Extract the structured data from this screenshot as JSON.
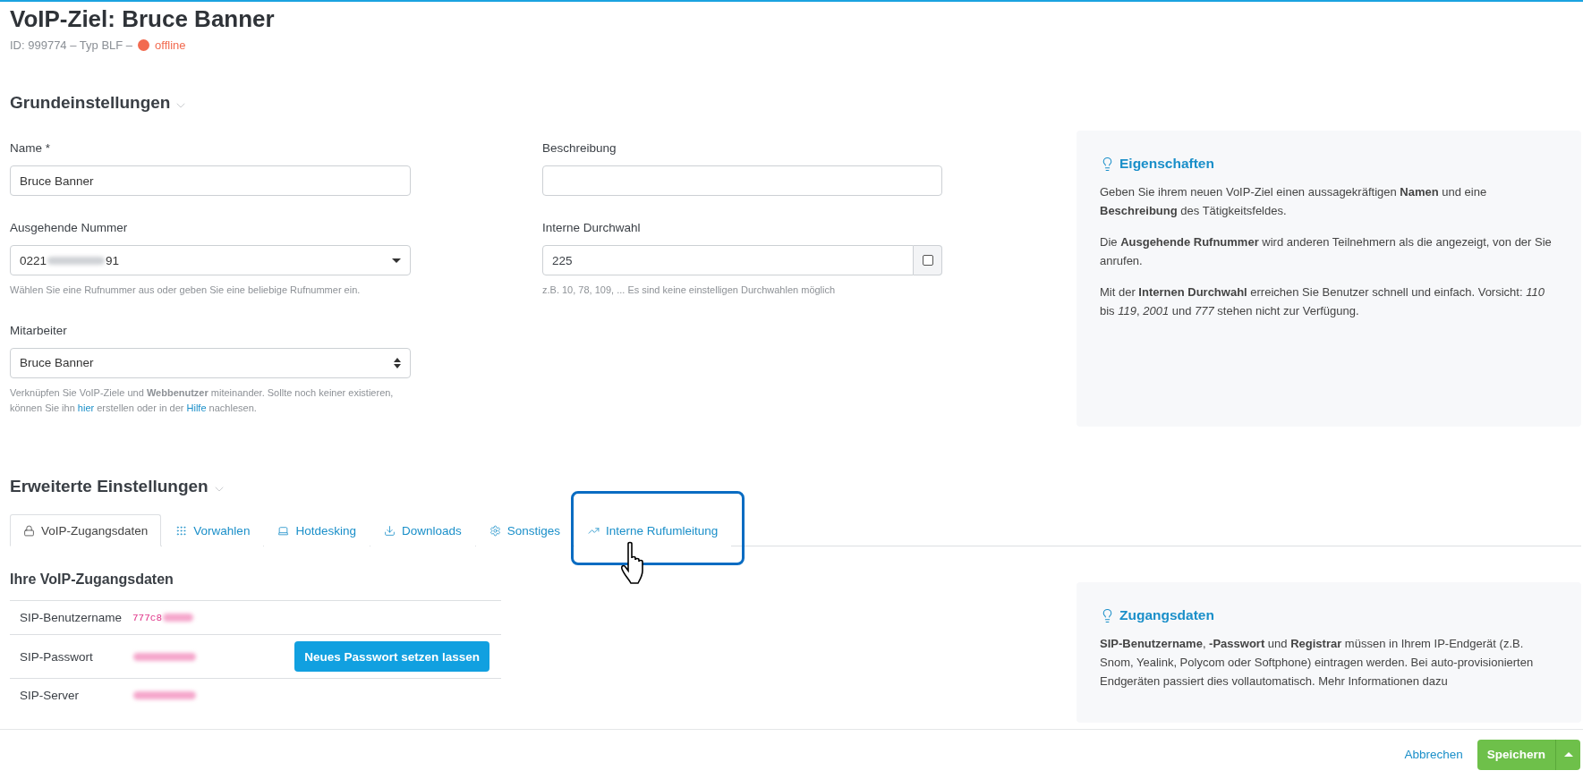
{
  "header": {
    "title": "VoIP-Ziel: Bruce Banner",
    "meta": "ID: 999774 – Typ BLF –",
    "online": false,
    "status": "offline"
  },
  "basic": {
    "title": "Grundeinstellungen",
    "fields": [
      {
        "kind": "text",
        "label": "Name *",
        "value": "Bruce Banner"
      },
      {
        "kind": "text",
        "label": "Beschreibung"
      },
      {
        "kind": "dropdown",
        "label": "Ausgehende Nummer",
        "value": "0221",
        "value_end": "91",
        "blurred": true,
        "hint": [
          {
            "text": "Wählen Sie eine Rufnummer aus oder geben Sie eine beliebige Rufnummer ein."
          }
        ]
      },
      {
        "kind": "checkbox-text",
        "label": "Interne Durchwahl",
        "value": "225",
        "checked": false,
        "hint": [
          {
            "text": "z.B. 10, 78, 109, ... Es sind keine einstelligen Durchwahlen möglich"
          }
        ]
      },
      {
        "kind": "select",
        "label": "Mitarbeiter",
        "value": "Bruce Banner",
        "hint": [
          {
            "text": "Verknüpfen Sie VoIP-Ziele und **Webbenutzer** miteinander. Sollte noch keiner existieren, können Sie ihn "
          },
          {
            "link": "hier"
          },
          {
            "text": " erstellen oder in der "
          },
          {
            "link": "Hilfe"
          },
          {
            "text": " nachlesen."
          }
        ]
      }
    ],
    "info": {
      "title": "Eigenschaften",
      "paragraphs": [
        "Geben Sie ihrem neuen VoIP-Ziel einen aussagekräftigen **Namen** und eine **Beschreibung** des Tätigkeitsfeldes.",
        "Die **Ausgehende Rufnummer** wird anderen Teilnehmern als die angezeigt, von der Sie anrufen.",
        "Mit der **Internen Durchwahl** erreichen Sie Benutzer schnell und einfach. Vorsicht: *110* bis *119*, *2001* und *777* stehen nicht zur Verfügung."
      ]
    }
  },
  "advanced": {
    "title": "Erweiterte Einstellungen",
    "tabs": [
      {
        "label": "VoIP-Zugangsdaten",
        "selected": true
      },
      {
        "label": "Vorwahlen",
        "selected": false
      },
      {
        "label": "Hotdesking",
        "selected": false
      },
      {
        "label": "Downloads",
        "selected": false
      },
      {
        "label": "Sonstiges",
        "selected": false
      },
      {
        "label": "Interne Rufumleitung",
        "selected": false
      }
    ],
    "subtitle": "Ihre VoIP-Zugangsdaten",
    "rows": [
      {
        "label": "SIP-Benutzername",
        "value": "777c8",
        "blurred": true
      },
      {
        "label": "SIP-Passwort",
        "blurred": true,
        "button": "Neues Passwort setzen lassen"
      },
      {
        "label": "SIP-Server",
        "blurred": true
      }
    ],
    "info": {
      "title": "Zugangsdaten",
      "paragraphs": [
        "**SIP-Benutzername**, **-Passwort** und **Registrar** müssen in Ihrem IP-Endgerät (z.B. Snom, Yealink, Polycom oder Softphone) eintragen werden. Bei auto-provisionierten Endgeräten passiert dies vollautomatisch. Mehr Informationen dazu"
      ]
    }
  },
  "footer": {
    "cancel": "Abbrechen",
    "save": "Speichern"
  }
}
